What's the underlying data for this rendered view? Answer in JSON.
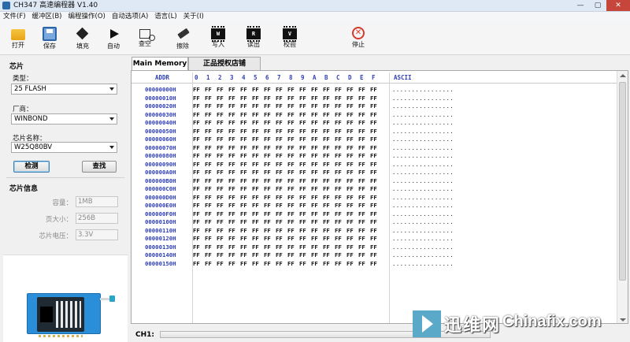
{
  "window": {
    "title": "CH347 高速编程器  V1.40",
    "min_glyph": "—",
    "max_glyph": "▢",
    "close_glyph": "✕"
  },
  "menu": [
    "文件(F)",
    "缓冲区(B)",
    "编程操作(O)",
    "自动选项(A)",
    "语言(L)",
    "关于(I)"
  ],
  "toolbar": {
    "open": "打开",
    "save": "保存",
    "fill": "填充",
    "auto": "自动",
    "check_blank": "查空",
    "erase": "擦除",
    "write": "写入",
    "read": "读出",
    "verify": "校验",
    "stop": "停止",
    "write_glyph": "W",
    "read_glyph": "R",
    "verify_glyph": "V",
    "stop_glyph": "✕"
  },
  "chip": {
    "section_title": "芯片",
    "type_label": "类型：",
    "type_value": "25 FLASH",
    "vendor_label": "厂商：",
    "vendor_value": "WINBOND",
    "name_label": "芯片名称：",
    "name_value": "W25Q80BV",
    "detect_button": "检测",
    "search_button": "查找"
  },
  "chip_info": {
    "section_title": "芯片信息",
    "capacity_label": "容量：",
    "capacity_value": "1MB",
    "page_label": "页大小：",
    "page_value": "256B",
    "voltage_label": "芯片电压：",
    "voltage_value": "3.3V"
  },
  "tabs": [
    "Main Memory",
    "正品授权店铺"
  ],
  "hex": {
    "addr_header": "ADDR",
    "ascii_header": "ASCII",
    "col_headers": [
      "0",
      "1",
      "2",
      "3",
      "4",
      "5",
      "6",
      "7",
      "8",
      "9",
      "A",
      "B",
      "C",
      "D",
      "E",
      "F"
    ],
    "fill_byte": "FF",
    "ascii_fill": "................",
    "rows": [
      "00000000H",
      "00000010H",
      "00000020H",
      "00000030H",
      "00000040H",
      "00000050H",
      "00000060H",
      "00000070H",
      "00000080H",
      "00000090H",
      "000000A0H",
      "000000B0H",
      "000000C0H",
      "000000D0H",
      "000000E0H",
      "000000F0H",
      "00000100H",
      "00000110H",
      "00000120H",
      "00000130H",
      "00000140H",
      "00000150H"
    ]
  },
  "status": {
    "channel_label": "CH1:"
  },
  "watermark": {
    "cn": "迅维网",
    "en": "Chinafix.com"
  }
}
